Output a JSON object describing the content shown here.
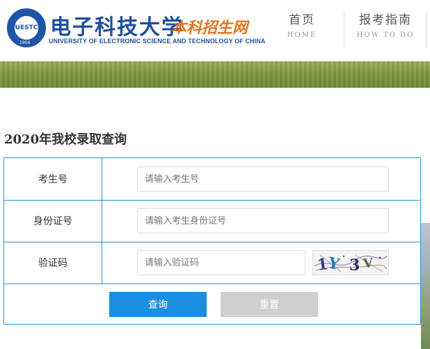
{
  "header": {
    "university_cn": "电子科技大学",
    "site_name": "本科招生网",
    "university_en": "UNIVERSITY OF ELECTRONIC SCIENCE AND TECHNOLOGY OF CHINA",
    "emblem_text": "UESTC",
    "emblem_year": "1956",
    "nav": [
      {
        "label": "首页",
        "sub": "HOME"
      },
      {
        "label": "报考指南",
        "sub": "HOW TO DO"
      }
    ]
  },
  "page": {
    "title": "2020年我校录取查询"
  },
  "form": {
    "fields": [
      {
        "label": "考生号",
        "placeholder": "请输入考生号"
      },
      {
        "label": "身份证号",
        "placeholder": "请输入考生身份证号"
      },
      {
        "label": "验证码",
        "placeholder": "请输入验证码"
      }
    ],
    "captcha_text": "1Y3V",
    "query_label": "查询",
    "reset_label": "重置"
  },
  "colors": {
    "brand_blue": "#1f4fa0",
    "site_orange": "#e4731c",
    "table_border": "#2f91d0",
    "query_button": "#1a8fe0",
    "reset_button": "#cfcfcf"
  }
}
